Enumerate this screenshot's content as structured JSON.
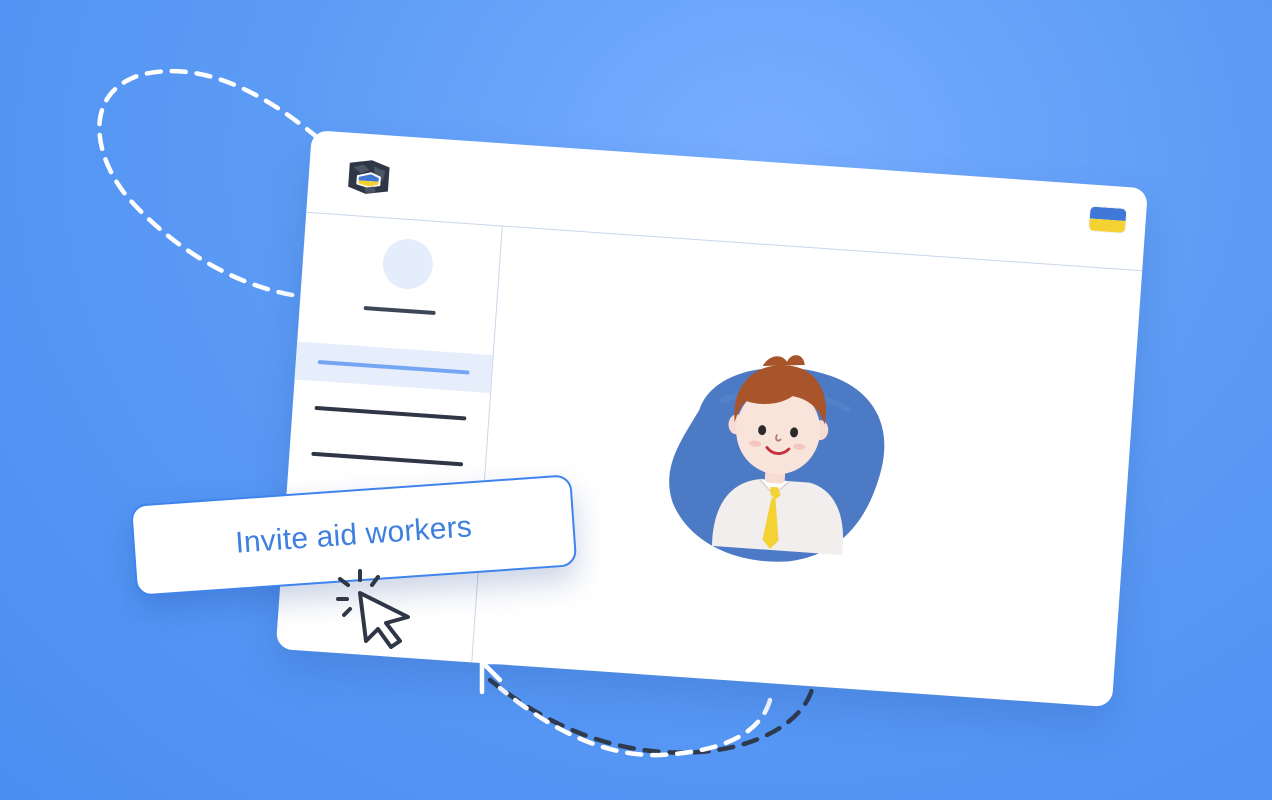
{
  "theme": {
    "background": "#5c9bf5",
    "accent": "#3f7fe0",
    "sidebar_active": "#75a6f3",
    "flag_blue": "#3f78d6",
    "flag_yellow": "#f4d234"
  },
  "window": {
    "logo_icon": "ukraine-shield-logo",
    "language_flag_icon": "ukraine-flag-icon"
  },
  "sidebar": {
    "items": [
      {
        "state": "active"
      },
      {
        "state": "default"
      },
      {
        "state": "default"
      }
    ]
  },
  "cta": {
    "label": "Invite aid workers"
  },
  "icons": [
    "dashed-arrow-right-icon",
    "dashed-arrow-up-icon",
    "pointer-cursor-icon",
    "aid-worker-illustration"
  ]
}
